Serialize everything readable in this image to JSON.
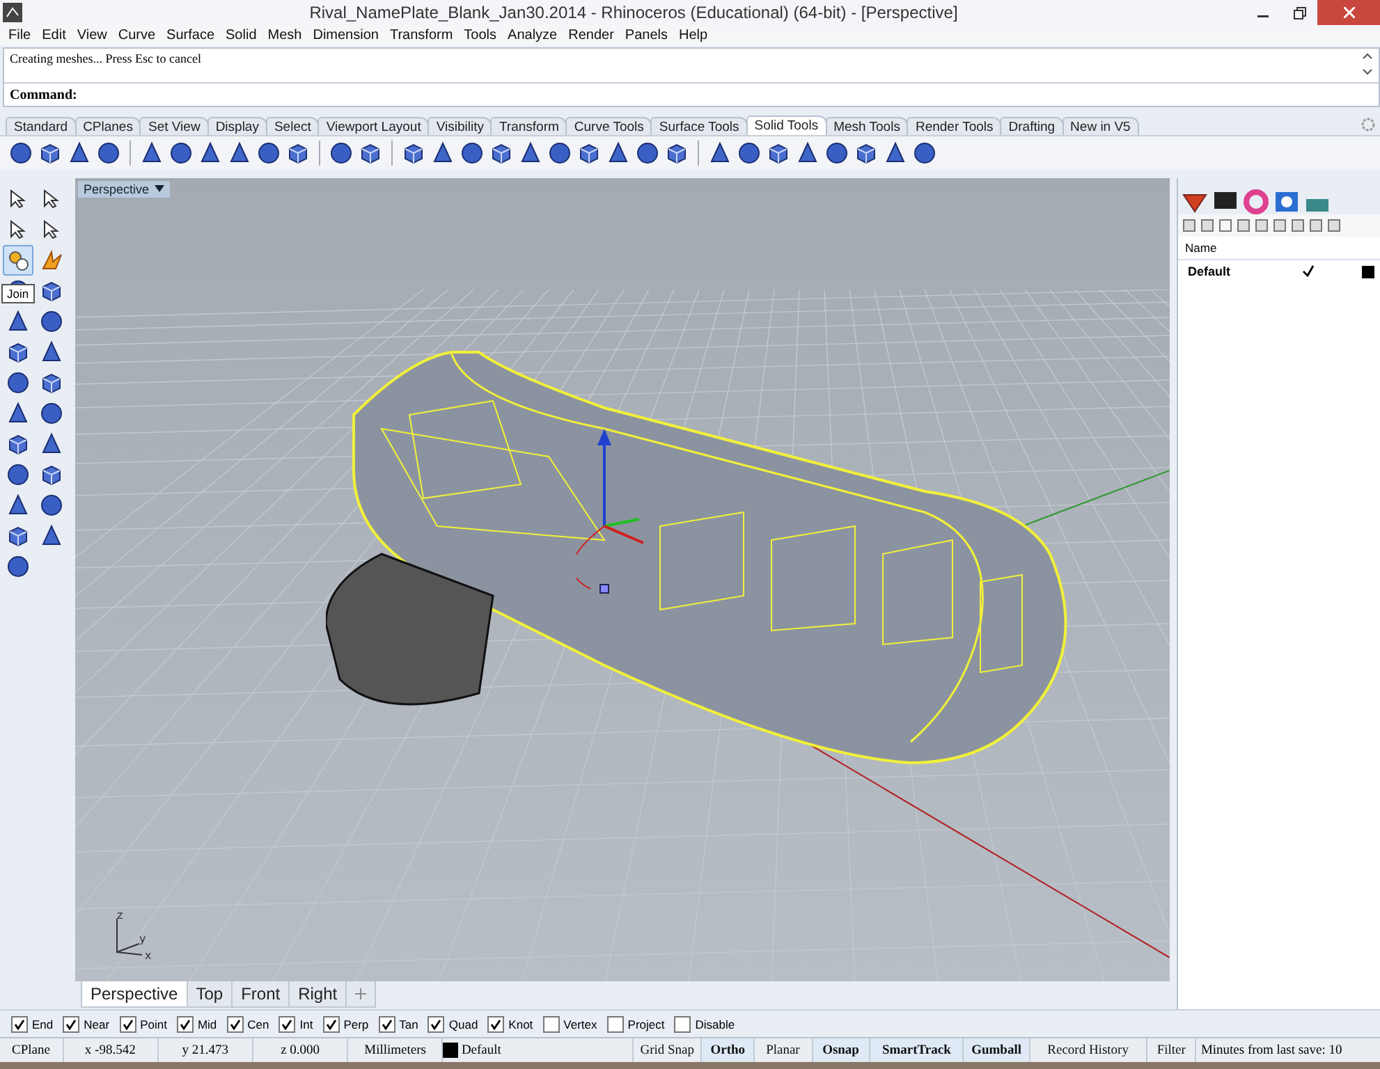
{
  "window": {
    "title": "Rival_NamePlate_Blank_Jan30.2014 - Rhinoceros (Educational) (64-bit) - [Perspective]"
  },
  "menu": [
    "File",
    "Edit",
    "View",
    "Curve",
    "Surface",
    "Solid",
    "Mesh",
    "Dimension",
    "Transform",
    "Tools",
    "Analyze",
    "Render",
    "Panels",
    "Help"
  ],
  "command_history": "Creating meshes... Press Esc to cancel",
  "command_prompt": "Command:",
  "toolbar_tabs": [
    {
      "label": "Standard",
      "selected": false
    },
    {
      "label": "CPlanes",
      "selected": false
    },
    {
      "label": "Set View",
      "selected": false
    },
    {
      "label": "Display",
      "selected": false
    },
    {
      "label": "Select",
      "selected": false
    },
    {
      "label": "Viewport Layout",
      "selected": false
    },
    {
      "label": "Visibility",
      "selected": false
    },
    {
      "label": "Transform",
      "selected": false
    },
    {
      "label": "Curve Tools",
      "selected": false
    },
    {
      "label": "Surface Tools",
      "selected": false
    },
    {
      "label": "Solid Tools",
      "selected": true
    },
    {
      "label": "Mesh Tools",
      "selected": false
    },
    {
      "label": "Render Tools",
      "selected": false
    },
    {
      "label": "Drafting",
      "selected": false
    },
    {
      "label": "New in V5",
      "selected": false
    }
  ],
  "tool_palette": {
    "tooltip": "Join",
    "tools": [
      {
        "selected": false
      },
      {
        "selected": false
      },
      {
        "selected": false
      },
      {
        "selected": false
      },
      {
        "selected": true
      },
      {
        "selected": false
      },
      {
        "selected": false
      },
      {
        "selected": false
      },
      {
        "selected": false
      },
      {
        "selected": false
      },
      {
        "selected": false
      },
      {
        "selected": false
      },
      {
        "selected": false
      },
      {
        "selected": false
      },
      {
        "selected": false
      },
      {
        "selected": false
      },
      {
        "selected": false
      },
      {
        "selected": false
      },
      {
        "selected": false
      },
      {
        "selected": false
      },
      {
        "selected": false
      },
      {
        "selected": false
      },
      {
        "selected": false
      },
      {
        "selected": false
      },
      {
        "selected": false
      }
    ]
  },
  "viewport": {
    "title": "Perspective",
    "axis_labels": [
      "z",
      "y",
      "x"
    ]
  },
  "viewport_tabs": [
    {
      "label": "Perspective",
      "selected": true
    },
    {
      "label": "Top",
      "selected": false
    },
    {
      "label": "Front",
      "selected": false
    },
    {
      "label": "Right",
      "selected": false
    }
  ],
  "layers_panel": {
    "column": "Name",
    "layers": [
      {
        "name": "Default",
        "current": true,
        "color": "#000000"
      }
    ]
  },
  "osnaps": [
    {
      "label": "End",
      "checked": true
    },
    {
      "label": "Near",
      "checked": true
    },
    {
      "label": "Point",
      "checked": true
    },
    {
      "label": "Mid",
      "checked": true
    },
    {
      "label": "Cen",
      "checked": true
    },
    {
      "label": "Int",
      "checked": true
    },
    {
      "label": "Perp",
      "checked": true
    },
    {
      "label": "Tan",
      "checked": true
    },
    {
      "label": "Quad",
      "checked": true
    },
    {
      "label": "Knot",
      "checked": true
    },
    {
      "label": "Vertex",
      "checked": false
    },
    {
      "label": "Project",
      "checked": false
    },
    {
      "label": "Disable",
      "checked": false
    }
  ],
  "status_bar": {
    "cplane": "CPlane",
    "x": "x -98.542",
    "y": "y 21.473",
    "z": "z 0.000",
    "units": "Millimeters",
    "layer": {
      "name": "Default",
      "color": "#000000"
    },
    "toggles": [
      {
        "label": "Grid Snap",
        "on": false
      },
      {
        "label": "Ortho",
        "on": true
      },
      {
        "label": "Planar",
        "on": false
      },
      {
        "label": "Osnap",
        "on": true
      },
      {
        "label": "SmartTrack",
        "on": true
      },
      {
        "label": "Gumball",
        "on": true
      },
      {
        "label": "Record History",
        "on": false
      },
      {
        "label": "Filter",
        "on": false
      }
    ],
    "save_info": "Minutes from last save: 10"
  }
}
